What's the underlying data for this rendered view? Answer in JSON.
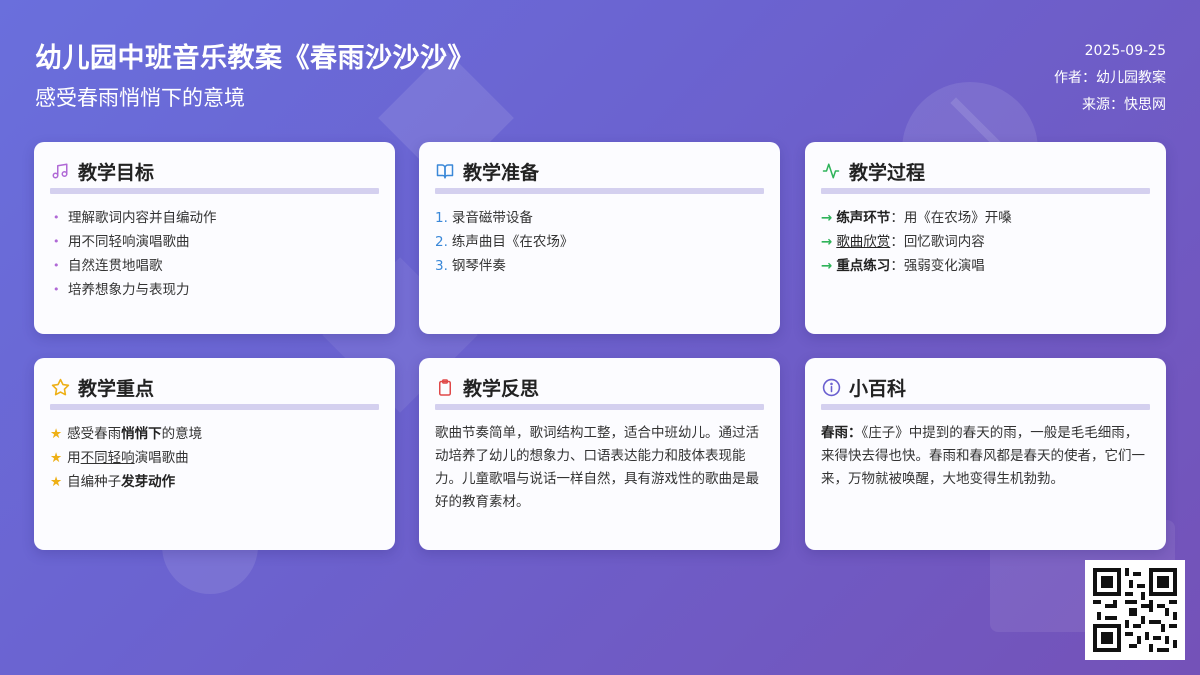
{
  "header": {
    "title": "幼儿园中班音乐教案《春雨沙沙沙》",
    "subtitle": "感受春雨悄悄下的意境",
    "date": "2025-09-25",
    "author": "作者：幼儿园教案",
    "source": "来源：快思网"
  },
  "colors": {
    "bg_start": "#6a6fdc",
    "bg_end": "#7452b8",
    "card_bg": "#fcfcff",
    "rule": "#d4d0ef",
    "music_icon": "#b069d6",
    "book_icon": "#3a88d8",
    "pulse_icon": "#2fb35a",
    "star_icon": "#eeb016",
    "clipboard_icon": "#e04848",
    "info_icon": "#6a5fd0"
  },
  "cards": {
    "goals": {
      "title": "教学目标",
      "icon": "music-note-icon",
      "items": [
        "理解歌词内容并自编动作",
        "用不同轻响演唱歌曲",
        "自然连贯地唱歌",
        "培养想象力与表现力"
      ]
    },
    "prep": {
      "title": "教学准备",
      "icon": "book-icon",
      "items": [
        {
          "num": "1.",
          "text": "录音磁带设备"
        },
        {
          "num": "2.",
          "text": "练声曲目《在农场》"
        },
        {
          "num": "3.",
          "text": "钢琴伴奏"
        }
      ]
    },
    "process": {
      "title": "教学过程",
      "icon": "pulse-icon",
      "steps": [
        {
          "arrow": "→",
          "label": "练声环节",
          "sep": "：",
          "text": "用《在农场》开嗓"
        },
        {
          "arrow": "→",
          "label": "歌曲欣赏",
          "sep": "：",
          "text": "回忆歌词内容"
        },
        {
          "arrow": "→",
          "label": "重点练习",
          "sep": "：",
          "text": "强弱变化演唱"
        }
      ]
    },
    "keypoints": {
      "title": "教学重点",
      "icon": "star-icon",
      "line1": {
        "star": "★",
        "pre": "感受春雨",
        "bold": "悄悄下",
        "post": "的意境"
      },
      "line2": {
        "star": "★",
        "pre": "用",
        "under": "不同轻响",
        "post": "演唱歌曲"
      },
      "line3": {
        "star": "★",
        "pre": "自编种子",
        "bold": "发芽动作",
        "post": ""
      }
    },
    "reflection": {
      "title": "教学反思",
      "icon": "clipboard-icon",
      "text": "歌曲节奏简单，歌词结构工整，适合中班幼儿。通过活动培养了幼儿的想象力、口语表达能力和肢体表现能力。儿童歌唱与说话一样自然，具有游戏性的歌曲是最好的教育素材。"
    },
    "encyclopedia": {
      "title": "小百科",
      "icon": "info-icon",
      "term": "春雨：",
      "text": "《庄子》中提到的春天的雨，一般是毛毛细雨，来得快去得也快。春雨和春风都是春天的使者，它们一来，万物就被唤醒，大地变得生机勃勃。"
    }
  }
}
